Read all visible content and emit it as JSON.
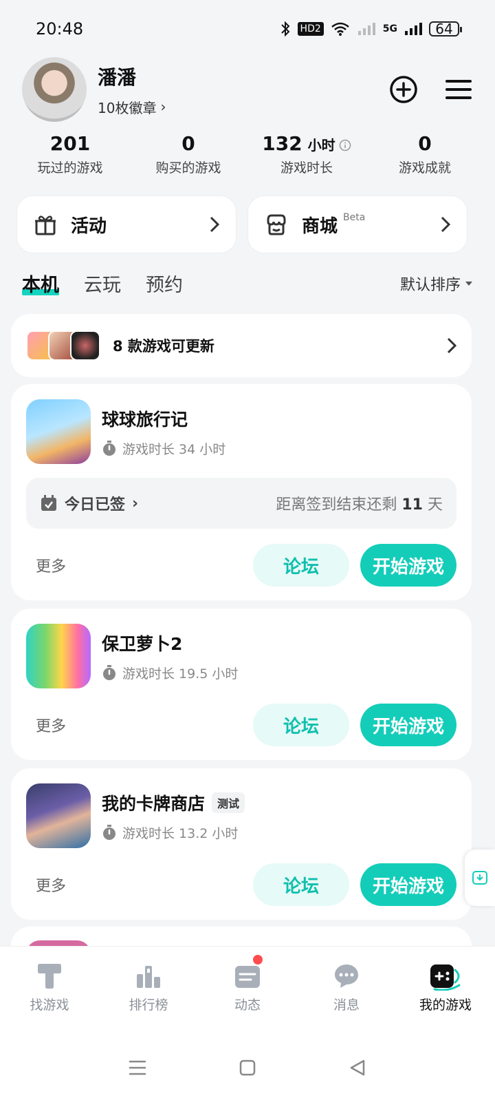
{
  "status_bar": {
    "time": "20:48",
    "bluetooth_icon": "bluetooth-icon",
    "hd_label": "HD2",
    "signal_5g": "5G",
    "battery": "64"
  },
  "profile": {
    "name": "潘潘",
    "badges": "10枚徽章",
    "add_icon": "plus-circle-icon",
    "menu_icon": "menu-icon"
  },
  "stats": [
    {
      "value": "201",
      "unit": "",
      "label": "玩过的游戏"
    },
    {
      "value": "0",
      "unit": "",
      "label": "购买的游戏"
    },
    {
      "value": "132",
      "unit": "小时",
      "label": "游戏时长"
    },
    {
      "value": "0",
      "unit": "",
      "label": "游戏成就"
    }
  ],
  "quick_cards": {
    "activity": {
      "label": "活动"
    },
    "shop": {
      "label": "商城",
      "beta": "Beta"
    }
  },
  "tabs": {
    "local": "本机",
    "cloud": "云玩",
    "reserve": "预约",
    "sort": "默认排序"
  },
  "update_banner": {
    "text": "8 款游戏可更新"
  },
  "games": [
    {
      "title": "球球旅行记",
      "tag": "",
      "time": "游戏时长 34 小时",
      "checkin_left": "今日已签",
      "checkin_right_prefix": "距离签到结束还剩",
      "checkin_days": "11",
      "checkin_right_suffix": "天",
      "more": "更多",
      "forum": "论坛",
      "play": "开始游戏"
    },
    {
      "title": "保卫萝卜2",
      "tag": "",
      "time": "游戏时长 19.5 小时",
      "more": "更多",
      "forum": "论坛",
      "play": "开始游戏"
    },
    {
      "title": "我的卡牌商店",
      "tag": "测试",
      "time": "游戏时长 13.2 小时",
      "more": "更多",
      "forum": "论坛",
      "play": "开始游戏"
    }
  ],
  "bottom_nav": [
    {
      "label": "找游戏",
      "icon": "find-game-icon"
    },
    {
      "label": "排行榜",
      "icon": "ranking-icon"
    },
    {
      "label": "动态",
      "icon": "feed-icon"
    },
    {
      "label": "消息",
      "icon": "message-icon"
    },
    {
      "label": "我的游戏",
      "icon": "my-games-icon"
    }
  ],
  "colors": {
    "accent": "#14CDB9",
    "forum_bg": "#E6FAF7",
    "red_dot": "#FF4D4F"
  }
}
